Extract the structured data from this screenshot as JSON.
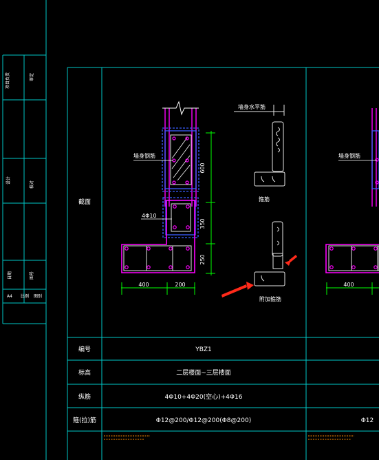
{
  "title_block": {
    "a1": "项目负责",
    "a2": "审定",
    "b1": "设计",
    "b2": "校对",
    "c1": "日期",
    "c2": "图号",
    "d1": "A4",
    "d2": "比例",
    "d3": "图别"
  },
  "row_labels": {
    "section": "截面",
    "number": "编号",
    "elevation": "标高",
    "longitudinal": "纵筋",
    "stirrup": "箍(拉)筋"
  },
  "drawing": {
    "wall_rebar": "墙身钢筋",
    "wall_horizontal": "墙身水平筋",
    "stirrup": "箍筋",
    "added_stirrup": "附加箍筋",
    "bars_4": "4Φ10",
    "dims": [
      "600",
      "350",
      "250",
      "400",
      "200"
    ],
    "dims_right": [
      "400"
    ],
    "wall_rebar_right": "墙身钢筋"
  },
  "table": {
    "number_value": "YBZ1",
    "elevation_value": "二层楼面~三层楼面",
    "longitudinal_value": "4Φ10+4Φ20(空心)+4Φ16",
    "stirrup_value": "Φ12@200/Φ12@200(Φ8@200)",
    "stirrup_value_right": "Φ12",
    "note_left": "",
    "note_right": ""
  },
  "colors": {
    "frame": "#00c8c8",
    "rebar": "#ff00ff",
    "column": "#3a5cff",
    "dim": "#00ff00",
    "text": "#ffffff",
    "arrow": "#ff2a1a",
    "note": "#ff8c00",
    "stirrup_outline": "#e6e6e6"
  }
}
